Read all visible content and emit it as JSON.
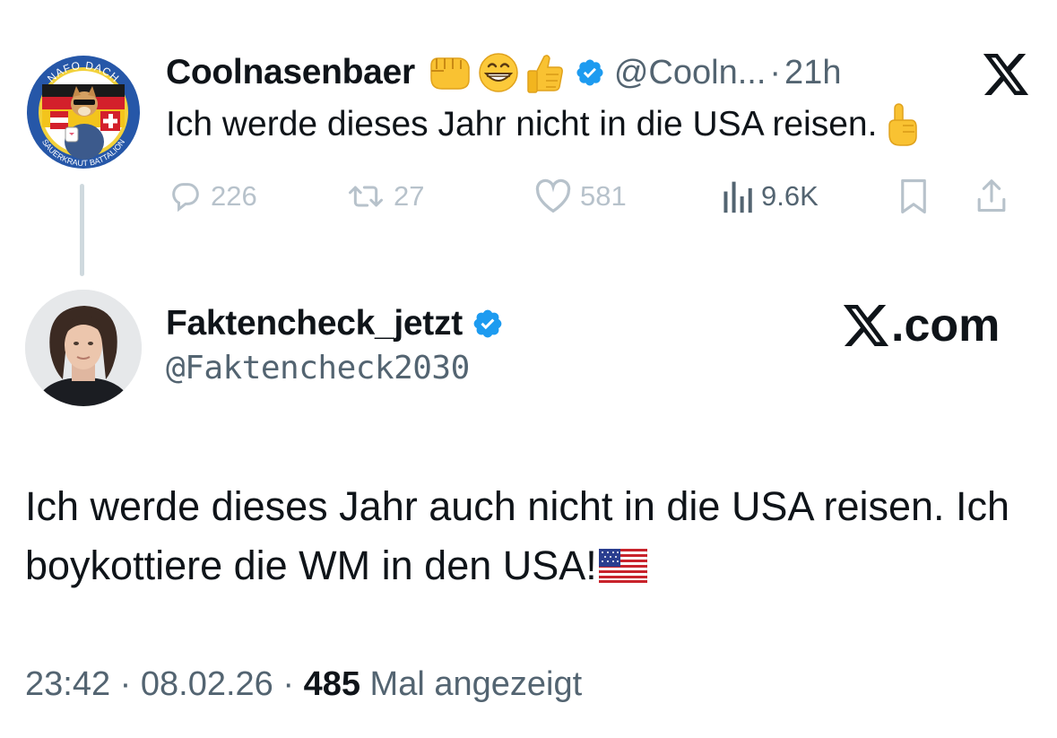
{
  "parent_tweet": {
    "avatar": {
      "ring_top": "NAFO DACH",
      "ring_bottom": "SAUERKRAUT BATTALION"
    },
    "display_name": "Coolnasenbaer",
    "name_emojis": [
      "fist-emoji",
      "grinning-face-emoji",
      "thumbs-up-emoji"
    ],
    "handle": "@Cooln...",
    "separator": "·",
    "time": "21h",
    "text": "Ich werde dieses Jahr nicht in die USA reisen.",
    "text_emoji": "index-pointing-up-emoji",
    "actions": {
      "replies": "226",
      "reposts": "27",
      "likes": "581",
      "views": "9.6K"
    }
  },
  "reply_tweet": {
    "display_name": "Faktencheck_jetzt",
    "handle": "@Faktencheck2030",
    "brand_label": ".com",
    "body": "Ich werde dieses Jahr auch nicht in die USA reisen. Ich boykottiere die WM in den USA!",
    "body_emoji": "us-flag-emoji",
    "time": "23:42",
    "date": "08.02.26",
    "views_count": "485",
    "views_label": "Mal angezeigt",
    "separator": "·"
  },
  "colors": {
    "verified_blue": "#1d9bf0",
    "secondary_text": "#536471",
    "primary_text": "#0f1419",
    "thread_line": "#cfd9de"
  }
}
